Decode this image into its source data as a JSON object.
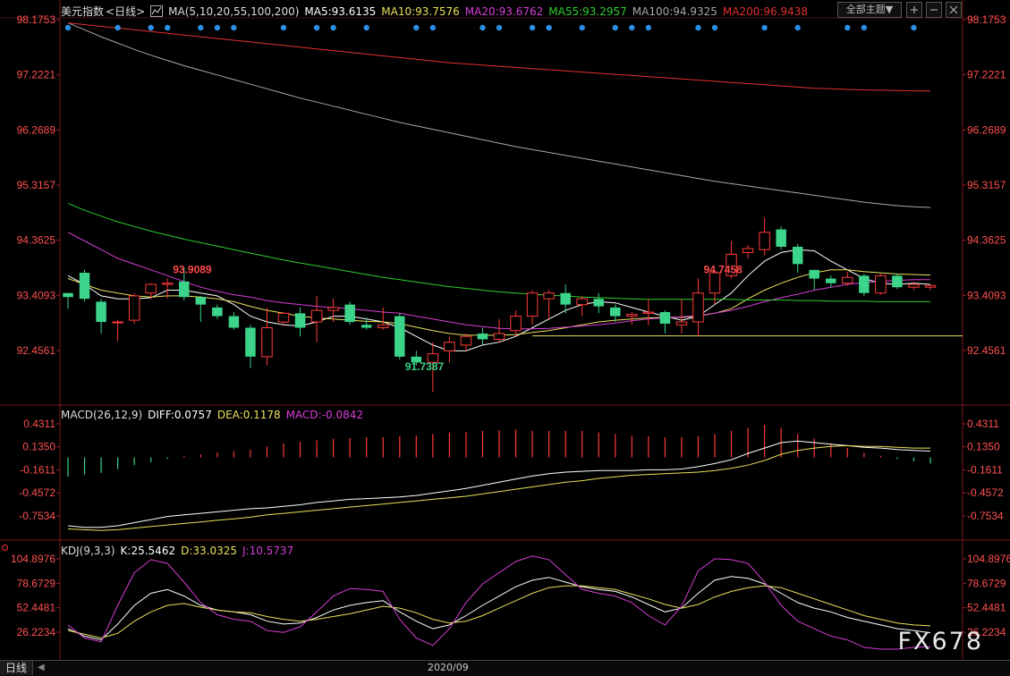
{
  "colors": {
    "up": "#ff3b3b",
    "down": "#3bd48a",
    "ma5": "#ffffff",
    "ma10": "#e8e05a",
    "ma20": "#d63fd6",
    "ma55": "#2ecc2e",
    "ma100": "#a8a8a8",
    "ma200": "#e03030",
    "support": "#e8e05a",
    "axis_label": "#ff5050",
    "grid": "#5a1a1a",
    "dots": "#2b8fe6"
  },
  "header_main": {
    "instrument": "美元指数",
    "period": "<日线>",
    "ma_def": "MA(5,10,20,55,100,200)",
    "ma5": "MA5:93.6135",
    "ma10": "MA10:93.7576",
    "ma20": "MA20:93.6762",
    "ma55": "MA55:93.2957",
    "ma100": "MA100:94.9325",
    "ma200": "MA200:96.9438",
    "theme_button": "全部主题▼"
  },
  "header_macd": {
    "def": "MACD(26,12,9)",
    "diff": "DIFF:0.0757",
    "dea": "DEA:0.1178",
    "macd": "MACD:-0.0842"
  },
  "header_kdj": {
    "def": "KDJ(9,3,3)",
    "k": "K:25.5462",
    "d": "D:33.0325",
    "j": "J:10.5737"
  },
  "footer": {
    "tab": "日线",
    "date": "2020/09"
  },
  "watermark": "FX678",
  "chart_data": [
    {
      "type": "candlestick",
      "title": "美元指数 日线",
      "y_ticks": [
        "98.1753",
        "97.2221",
        "96.2689",
        "95.3157",
        "94.3625",
        "93.4093",
        "92.4561"
      ],
      "y_tick_values": [
        98.1753,
        97.2221,
        96.2689,
        95.3157,
        94.3625,
        93.4093,
        92.4561
      ],
      "ylim": [
        91.6,
        98.2
      ],
      "annotations": [
        {
          "text": "93.9089",
          "index": 6
        },
        {
          "text": "94.7458",
          "index": 38
        },
        {
          "text": "91.7387",
          "index": 20
        }
      ],
      "support_level": 92.71,
      "candles": [
        [
          93.45,
          93.38,
          93.45,
          93.18
        ],
        [
          93.8,
          93.35,
          93.85,
          93.3
        ],
        [
          93.3,
          92.95,
          93.35,
          92.75
        ],
        [
          92.95,
          92.95,
          92.99,
          92.62
        ],
        [
          92.98,
          93.4,
          93.45,
          92.92
        ],
        [
          93.45,
          93.6,
          93.62,
          93.35
        ],
        [
          93.6,
          93.62,
          93.7,
          93.35
        ],
        [
          93.65,
          93.38,
          93.9,
          93.32
        ],
        [
          93.38,
          93.25,
          93.4,
          92.95
        ],
        [
          93.2,
          93.05,
          93.25,
          93.0
        ],
        [
          93.05,
          92.85,
          93.12,
          92.82
        ],
        [
          92.85,
          92.35,
          92.9,
          92.15
        ],
        [
          92.35,
          92.85,
          93.2,
          92.2
        ],
        [
          92.95,
          93.1,
          93.12,
          92.9
        ],
        [
          93.1,
          92.85,
          93.2,
          92.7
        ],
        [
          92.95,
          93.15,
          93.4,
          92.6
        ],
        [
          93.15,
          93.2,
          93.35,
          92.95
        ],
        [
          93.25,
          92.95,
          93.3,
          92.9
        ],
        [
          92.9,
          92.85,
          93.02,
          92.82
        ],
        [
          92.85,
          92.9,
          93.2,
          92.82
        ],
        [
          93.05,
          92.35,
          93.1,
          92.3
        ],
        [
          92.35,
          92.25,
          92.45,
          92.2
        ],
        [
          92.25,
          92.4,
          92.6,
          91.74
        ],
        [
          92.45,
          92.6,
          92.7,
          92.25
        ],
        [
          92.55,
          92.7,
          92.75,
          92.45
        ],
        [
          92.75,
          92.65,
          92.85,
          92.55
        ],
        [
          92.65,
          92.75,
          93.0,
          92.6
        ],
        [
          92.8,
          93.05,
          93.15,
          92.7
        ],
        [
          93.05,
          93.45,
          93.5,
          92.9
        ],
        [
          93.35,
          93.45,
          93.5,
          93.0
        ],
        [
          93.45,
          93.25,
          93.6,
          93.1
        ],
        [
          93.25,
          93.35,
          93.4,
          93.05
        ],
        [
          93.35,
          93.22,
          93.45,
          93.1
        ],
        [
          93.2,
          93.05,
          93.25,
          92.95
        ],
        [
          93.05,
          93.08,
          93.12,
          92.9
        ],
        [
          93.1,
          93.12,
          93.35,
          92.9
        ],
        [
          93.12,
          92.92,
          93.15,
          92.75
        ],
        [
          92.9,
          92.95,
          93.35,
          92.75
        ],
        [
          92.95,
          93.45,
          93.7,
          92.7
        ],
        [
          93.45,
          93.8,
          93.85,
          93.25
        ],
        [
          93.75,
          94.12,
          94.35,
          93.7
        ],
        [
          94.15,
          94.22,
          94.28,
          94.05
        ],
        [
          94.2,
          94.5,
          94.75,
          94.1
        ],
        [
          94.55,
          94.25,
          94.6,
          94.2
        ],
        [
          94.25,
          93.95,
          94.3,
          93.8
        ],
        [
          93.85,
          93.7,
          93.85,
          93.5
        ],
        [
          93.7,
          93.62,
          93.75,
          93.55
        ],
        [
          93.62,
          93.72,
          93.82,
          93.58
        ],
        [
          93.75,
          93.45,
          93.78,
          93.4
        ],
        [
          93.45,
          93.75,
          93.78,
          93.42
        ],
        [
          93.75,
          93.55,
          93.78,
          93.52
        ],
        [
          93.55,
          93.6,
          93.65,
          93.5
        ],
        [
          93.55,
          93.58,
          93.6,
          93.5
        ]
      ],
      "ma_series": {
        "MA5": [
          93.75,
          93.6,
          93.4,
          93.35,
          93.35,
          93.37,
          93.5,
          93.5,
          93.45,
          93.4,
          93.25,
          93.05,
          92.95,
          92.9,
          92.88,
          92.95,
          93.05,
          93.05,
          93.0,
          92.95,
          92.85,
          92.7,
          92.55,
          92.45,
          92.45,
          92.55,
          92.6,
          92.7,
          92.85,
          93.0,
          93.15,
          93.25,
          93.3,
          93.28,
          93.2,
          93.12,
          93.05,
          92.98,
          93.05,
          93.25,
          93.45,
          93.75,
          94.0,
          94.15,
          94.2,
          94.18,
          94.0,
          93.85,
          93.7,
          93.62,
          93.6,
          93.62,
          93.6
        ],
        "MA10": [
          93.7,
          93.6,
          93.5,
          93.45,
          93.4,
          93.38,
          93.4,
          93.4,
          93.38,
          93.35,
          93.3,
          93.22,
          93.15,
          93.1,
          93.05,
          93.02,
          93.0,
          92.98,
          92.96,
          92.95,
          92.92,
          92.86,
          92.8,
          92.75,
          92.72,
          92.72,
          92.72,
          92.73,
          92.77,
          92.8,
          92.85,
          92.9,
          92.95,
          92.98,
          93.0,
          93.02,
          93.03,
          93.03,
          93.05,
          93.1,
          93.18,
          93.35,
          93.5,
          93.62,
          93.72,
          93.8,
          93.85,
          93.85,
          93.82,
          93.8,
          93.78,
          93.77,
          93.76
        ],
        "MA20": [
          94.5,
          94.35,
          94.2,
          94.05,
          93.95,
          93.85,
          93.75,
          93.65,
          93.55,
          93.48,
          93.42,
          93.38,
          93.32,
          93.28,
          93.25,
          93.22,
          93.2,
          93.18,
          93.15,
          93.12,
          93.1,
          93.05,
          93.0,
          92.95,
          92.9,
          92.87,
          92.84,
          92.83,
          92.83,
          92.84,
          92.86,
          92.88,
          92.9,
          92.93,
          92.97,
          93.0,
          93.02,
          93.04,
          93.06,
          93.1,
          93.15,
          93.22,
          93.3,
          93.37,
          93.43,
          93.5,
          93.55,
          93.6,
          93.63,
          93.65,
          93.67,
          93.68,
          93.68
        ],
        "MA55": [
          95.0,
          94.88,
          94.78,
          94.68,
          94.6,
          94.52,
          94.45,
          94.38,
          94.32,
          94.26,
          94.2,
          94.14,
          94.08,
          94.02,
          93.97,
          93.92,
          93.87,
          93.82,
          93.77,
          93.72,
          93.68,
          93.64,
          93.6,
          93.56,
          93.53,
          93.5,
          93.47,
          93.45,
          93.43,
          93.41,
          93.4,
          93.38,
          93.37,
          93.36,
          93.35,
          93.34,
          93.34,
          93.34,
          93.34,
          93.34,
          93.34,
          93.33,
          93.33,
          93.33,
          93.32,
          93.32,
          93.31,
          93.31,
          93.31,
          93.3,
          93.3,
          93.3,
          93.3
        ],
        "MA100": [
          98.12,
          98.0,
          97.88,
          97.77,
          97.66,
          97.56,
          97.47,
          97.38,
          97.3,
          97.22,
          97.14,
          97.06,
          96.98,
          96.9,
          96.82,
          96.75,
          96.68,
          96.61,
          96.54,
          96.47,
          96.4,
          96.34,
          96.28,
          96.22,
          96.16,
          96.1,
          96.04,
          95.98,
          95.93,
          95.88,
          95.83,
          95.78,
          95.73,
          95.68,
          95.63,
          95.58,
          95.53,
          95.48,
          95.43,
          95.38,
          95.34,
          95.3,
          95.26,
          95.22,
          95.18,
          95.14,
          95.1,
          95.06,
          95.02,
          94.99,
          94.96,
          94.94,
          94.93
        ],
        "MA200": [
          98.12,
          98.09,
          98.06,
          98.03,
          98.0,
          97.97,
          97.94,
          97.91,
          97.88,
          97.85,
          97.82,
          97.79,
          97.76,
          97.73,
          97.7,
          97.67,
          97.64,
          97.61,
          97.58,
          97.55,
          97.52,
          97.49,
          97.46,
          97.43,
          97.41,
          97.39,
          97.37,
          97.35,
          97.33,
          97.31,
          97.29,
          97.27,
          97.25,
          97.23,
          97.21,
          97.19,
          97.17,
          97.15,
          97.13,
          97.11,
          97.09,
          97.07,
          97.05,
          97.03,
          97.01,
          96.99,
          96.98,
          96.97,
          96.96,
          96.955,
          96.95,
          96.945,
          96.944
        ]
      },
      "signal_dots_index": [
        0,
        3,
        5,
        6,
        8,
        9,
        10,
        13,
        15,
        16,
        18,
        21,
        22,
        25,
        26,
        28,
        29,
        31,
        33,
        34,
        35,
        38,
        39,
        42,
        44,
        47,
        48,
        51,
        55
      ]
    },
    {
      "type": "bar+line",
      "title": "MACD(26,12,9)",
      "y_ticks": [
        "0.4311",
        "0.1350",
        "-0.1611",
        "-0.4572",
        "-0.7534"
      ],
      "y_tick_values": [
        0.4311,
        0.135,
        -0.1611,
        -0.4572,
        -0.7534
      ],
      "ylim": [
        -0.96,
        0.55
      ],
      "histogram": [
        -0.25,
        -0.22,
        -0.2,
        -0.15,
        -0.1,
        -0.06,
        -0.02,
        0.02,
        0.04,
        0.06,
        0.08,
        0.1,
        0.14,
        0.18,
        0.2,
        0.22,
        0.24,
        0.25,
        0.26,
        0.26,
        0.27,
        0.28,
        0.3,
        0.32,
        0.33,
        0.34,
        0.35,
        0.36,
        0.34,
        0.34,
        0.34,
        0.34,
        0.32,
        0.3,
        0.28,
        0.27,
        0.26,
        0.26,
        0.27,
        0.3,
        0.34,
        0.38,
        0.42,
        0.38,
        0.3,
        0.24,
        0.18,
        0.12,
        0.06,
        0.02,
        -0.02,
        -0.05,
        -0.08
      ],
      "diff": [
        -0.88,
        -0.9,
        -0.9,
        -0.88,
        -0.84,
        -0.8,
        -0.76,
        -0.74,
        -0.72,
        -0.7,
        -0.68,
        -0.66,
        -0.65,
        -0.63,
        -0.61,
        -0.58,
        -0.56,
        -0.54,
        -0.53,
        -0.52,
        -0.51,
        -0.49,
        -0.46,
        -0.43,
        -0.4,
        -0.36,
        -0.32,
        -0.28,
        -0.24,
        -0.21,
        -0.19,
        -0.18,
        -0.17,
        -0.17,
        -0.17,
        -0.16,
        -0.16,
        -0.15,
        -0.12,
        -0.08,
        -0.03,
        0.05,
        0.12,
        0.19,
        0.21,
        0.19,
        0.17,
        0.15,
        0.13,
        0.12,
        0.1,
        0.09,
        0.08
      ],
      "dea": [
        -0.92,
        -0.93,
        -0.94,
        -0.93,
        -0.91,
        -0.89,
        -0.87,
        -0.85,
        -0.83,
        -0.81,
        -0.79,
        -0.77,
        -0.74,
        -0.72,
        -0.7,
        -0.68,
        -0.66,
        -0.64,
        -0.62,
        -0.6,
        -0.58,
        -0.56,
        -0.54,
        -0.52,
        -0.5,
        -0.47,
        -0.44,
        -0.41,
        -0.38,
        -0.35,
        -0.32,
        -0.3,
        -0.27,
        -0.25,
        -0.23,
        -0.22,
        -0.21,
        -0.2,
        -0.19,
        -0.17,
        -0.14,
        -0.1,
        -0.04,
        0.04,
        0.09,
        0.12,
        0.14,
        0.15,
        0.14,
        0.14,
        0.13,
        0.12,
        0.12
      ]
    },
    {
      "type": "line",
      "title": "KDJ(9,3,3)",
      "y_ticks": [
        "104.8976",
        "78.6729",
        "52.4481",
        "26.2234"
      ],
      "y_tick_values": [
        104.8976,
        78.6729,
        52.4481,
        26.2234
      ],
      "ylim": [
        5,
        108
      ],
      "k": [
        30,
        22,
        18,
        35,
        55,
        68,
        72,
        65,
        55,
        50,
        48,
        45,
        38,
        35,
        36,
        42,
        50,
        55,
        58,
        60,
        48,
        38,
        30,
        34,
        44,
        55,
        65,
        75,
        82,
        85,
        80,
        75,
        72,
        70,
        64,
        56,
        48,
        52,
        68,
        82,
        86,
        84,
        78,
        68,
        58,
        52,
        48,
        42,
        38,
        34,
        30,
        28,
        25.5
      ],
      "d": [
        28,
        24,
        20,
        25,
        38,
        48,
        55,
        57,
        53,
        50,
        48,
        47,
        43,
        40,
        38,
        40,
        43,
        46,
        50,
        54,
        52,
        47,
        40,
        36,
        38,
        44,
        52,
        60,
        68,
        74,
        76,
        76,
        74,
        72,
        67,
        62,
        56,
        52,
        56,
        64,
        70,
        74,
        76,
        74,
        68,
        62,
        56,
        50,
        44,
        40,
        36,
        34,
        33
      ],
      "j": [
        34,
        20,
        16,
        55,
        90,
        104,
        100,
        80,
        58,
        45,
        40,
        38,
        28,
        26,
        32,
        48,
        65,
        73,
        72,
        70,
        40,
        20,
        12,
        30,
        58,
        78,
        90,
        102,
        108,
        104,
        88,
        72,
        68,
        65,
        58,
        44,
        34,
        54,
        92,
        105,
        104,
        100,
        80,
        55,
        38,
        30,
        22,
        18,
        10,
        8,
        8,
        10,
        10.5
      ]
    }
  ]
}
